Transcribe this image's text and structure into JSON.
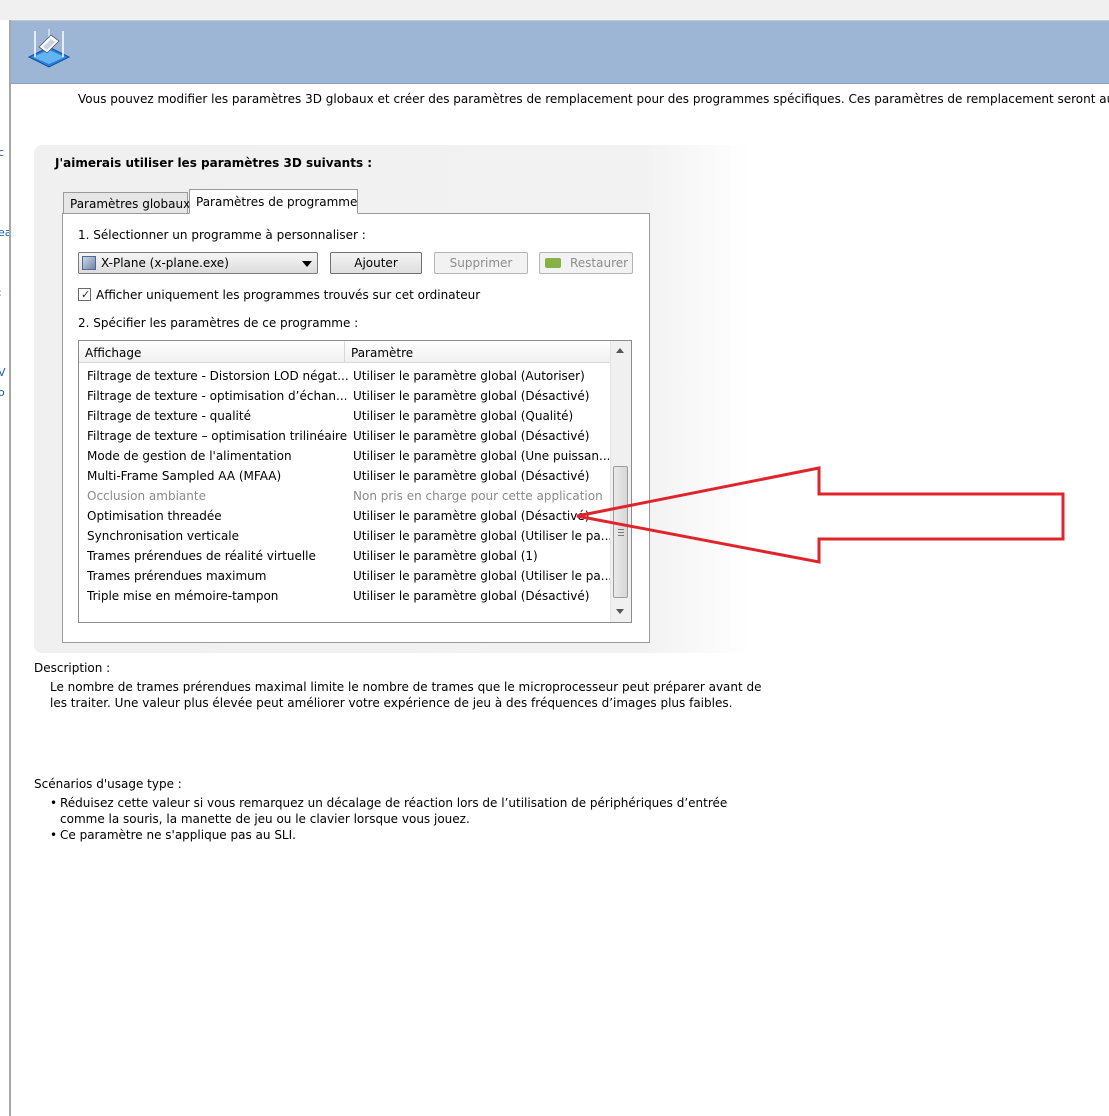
{
  "header": {
    "intro": "Vous pouvez modifier les paramètres 3D globaux et créer des paramètres de remplacement pour des programmes spécifiques. Ces paramètres de remplacement seront auto"
  },
  "group": {
    "title": "J'aimerais utiliser les paramètres 3D suivants :"
  },
  "tabs": [
    {
      "label": "Paramètres globaux",
      "active": false
    },
    {
      "label": "Paramètres de programme",
      "active": true
    }
  ],
  "program": {
    "select_label": "1. Sélectionner un programme à personnaliser :",
    "selected": "X-Plane (x-plane.exe)",
    "add_label": "Ajouter",
    "remove_label": "Supprimer",
    "restore_label": "Restaurer",
    "show_only_label": "Afficher uniquement les programmes trouvés sur cet ordinateur",
    "show_only_checked": true
  },
  "settings": {
    "specify_label": "2. Spécifier les paramètres de ce programme :",
    "columns": [
      "Affichage",
      "Paramètre"
    ],
    "rows": [
      {
        "feature": "Filtrage de texture - Distorsion LOD négat...",
        "value": "Utiliser le paramètre global (Autoriser)"
      },
      {
        "feature": "Filtrage de texture - optimisation d’échan...",
        "value": "Utiliser le paramètre global (Désactivé)"
      },
      {
        "feature": "Filtrage de texture - qualité",
        "value": "Utiliser le paramètre global (Qualité)"
      },
      {
        "feature": "Filtrage de texture – optimisation trilinéaire",
        "value": "Utiliser le paramètre global (Désactivé)"
      },
      {
        "feature": "Mode de gestion de l'alimentation",
        "value": "Utiliser le paramètre global (Une puissan..."
      },
      {
        "feature": "Multi-Frame Sampled AA (MFAA)",
        "value": "Utiliser le paramètre global (Désactivé)"
      },
      {
        "feature": "Occlusion ambiante",
        "value": "Non pris en charge pour cette application",
        "disabled": true
      },
      {
        "feature": "Optimisation threadée",
        "value": "Utiliser le paramètre global (Désactivé)"
      },
      {
        "feature": "Synchronisation verticale",
        "value": "Utiliser le paramètre global (Utiliser le pa..."
      },
      {
        "feature": "Trames prérendues de réalité virtuelle",
        "value": "Utiliser le paramètre global (1)"
      },
      {
        "feature": "Trames prérendues maximum",
        "value": "Utiliser le paramètre global (Utiliser le pa..."
      },
      {
        "feature": "Triple mise en mémoire-tampon",
        "value": "Utiliser le paramètre global (Désactivé)"
      }
    ]
  },
  "description": {
    "title": "Description :",
    "text": "Le nombre de trames prérendues maximal limite le nombre de trames que le microprocesseur peut préparer avant de les traiter. Une valeur plus élevée peut améliorer votre expérience de jeu à des fréquences d’images plus faibles."
  },
  "usage": {
    "title": "Scénarios d'usage type :",
    "items": [
      "Réduisez cette valeur si vous remarquez un décalage de réaction lors de l’utilisation de périphériques d’entrée comme la souris, la manette de jeu ou le clavier lorsque vous jouez.",
      "Ce paramètre ne s'applique pas au SLI."
    ]
  },
  "left_fragments": [
    "c",
    "ea",
    ":",
    "V",
    "o"
  ],
  "colors": {
    "header": "#9eb6d6",
    "arrow": "#e0242c",
    "nvidia": "#86b04a"
  }
}
